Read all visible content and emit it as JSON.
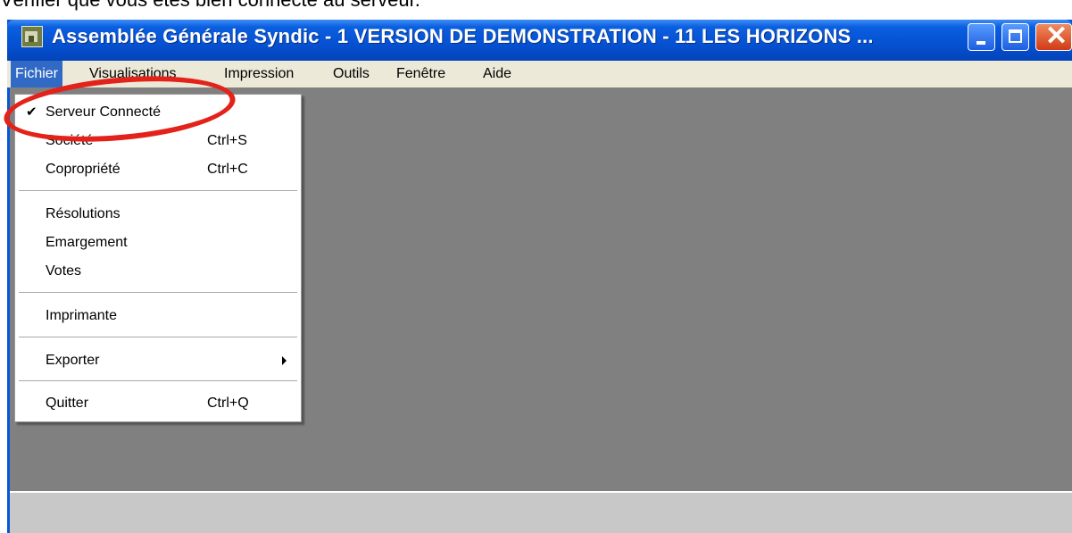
{
  "caption": "Vérifier que vous êtes bien connecté au serveur.",
  "window": {
    "title": "Assemblée Générale Syndic  - 1  VERSION DE DEMONSTRATION - 11  LES HORIZONS  ...",
    "icon": "app-house-icon",
    "close_glyph": "✕"
  },
  "menubar": {
    "items": [
      "Fichier",
      "Visualisations",
      "Impression",
      "Outils",
      "Fenêtre",
      "Aide"
    ],
    "active": "Fichier"
  },
  "file_menu": {
    "items": [
      {
        "label": "Serveur Connecté",
        "shortcut": "",
        "checked": true,
        "check_glyph": "✔"
      },
      {
        "label": "Société",
        "shortcut": "Ctrl+S"
      },
      {
        "label": "Copropriété",
        "shortcut": "Ctrl+C"
      },
      {
        "label": "Résolutions",
        "shortcut": ""
      },
      {
        "label": "Emargement",
        "shortcut": ""
      },
      {
        "label": "Votes",
        "shortcut": ""
      },
      {
        "label": "Imprimante",
        "shortcut": ""
      },
      {
        "label": "Exporter",
        "shortcut": "",
        "submenu": true
      },
      {
        "label": "Quitter",
        "shortcut": "Ctrl+Q"
      }
    ]
  },
  "colors": {
    "titlebar": "#0551d2",
    "menu_highlight": "#316ac5",
    "mdi_background": "#808080",
    "annotation_circle": "#e3221a"
  }
}
